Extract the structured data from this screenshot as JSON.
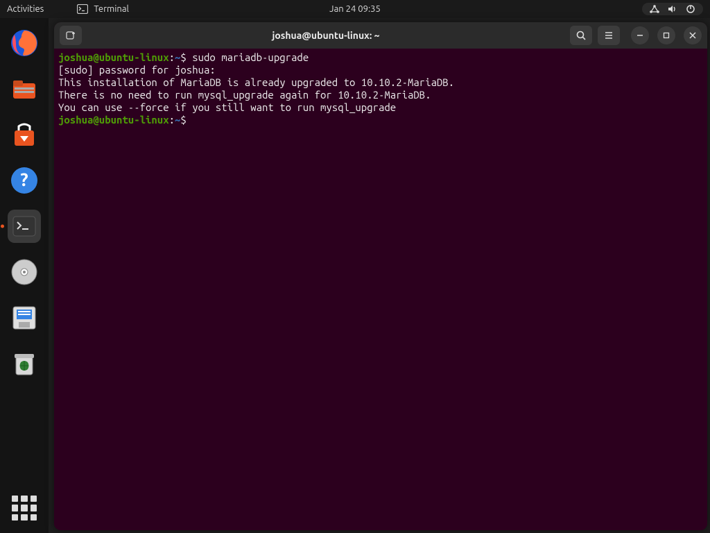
{
  "topbar": {
    "activities": "Activities",
    "app_label": "Terminal",
    "clock": "Jan 24  09:35"
  },
  "titlebar": {
    "title": "joshua@ubuntu-linux: ~"
  },
  "terminal": {
    "prompt_user": "joshua@ubuntu-linux",
    "prompt_sep": ":",
    "prompt_path": "~",
    "prompt_sym": "$",
    "cmd1": "sudo mariadb-upgrade",
    "line2": "[sudo] password for joshua:",
    "line3": "This installation of MariaDB is already upgraded to 10.10.2-MariaDB.",
    "line4": "There is no need to run mysql_upgrade again for 10.10.2-MariaDB.",
    "line5": "You can use --force if you still want to run mysql_upgrade",
    "cmd2": ""
  },
  "dock_items": [
    "firefox",
    "files",
    "software",
    "help",
    "terminal",
    "disks",
    "save",
    "trash"
  ]
}
